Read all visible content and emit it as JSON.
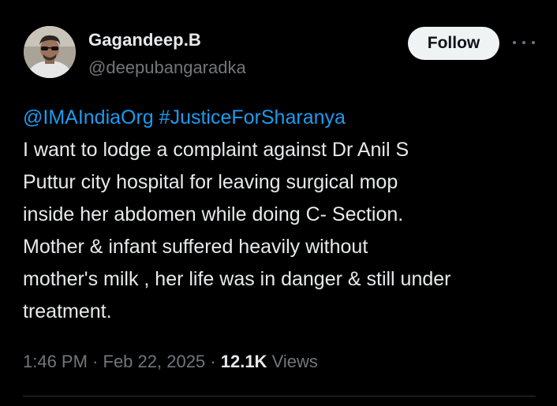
{
  "author": {
    "display_name": "Gagandeep.B",
    "handle": "@deepubangaradka"
  },
  "actions": {
    "follow_label": "Follow",
    "more_icon": "more-horizontal-icon"
  },
  "tweet": {
    "mention": "@IMAIndiaOrg",
    "hashtag": "#JusticeForSharanya",
    "lines": [
      "I want to lodge a complaint against Dr Anil S",
      "Puttur city hospital for leaving surgical mop",
      "inside her abdomen while doing C- Section.",
      "Mother & infant suffered heavily without",
      "mother's milk , her life was in danger & still under",
      "treatment."
    ]
  },
  "meta": {
    "time": "1:46 PM",
    "separator": " · ",
    "date": "Feb 22, 2025",
    "views_count": "12.1K",
    "views_label": "Views"
  },
  "colors": {
    "background": "#000000",
    "text": "#e7e9ea",
    "secondary": "#71767b",
    "link": "#1d9bf0",
    "button_bg": "#eff3f4",
    "divider": "#2f3336"
  }
}
